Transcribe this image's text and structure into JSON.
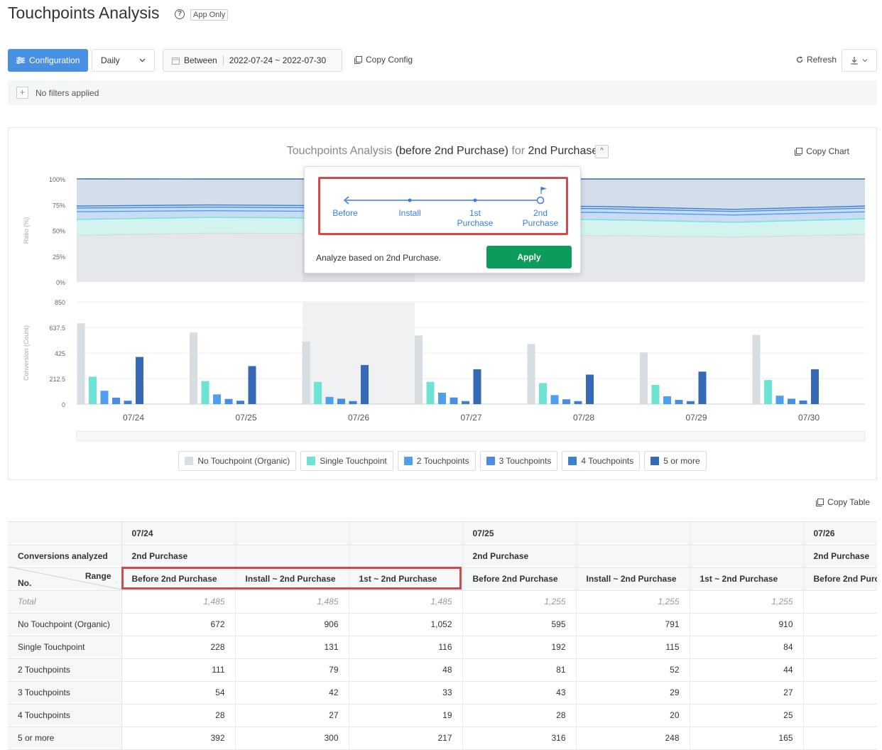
{
  "page": {
    "title": "Touchpoints Analysis",
    "help_icon": "?",
    "badge": "App Only"
  },
  "toolbar": {
    "configuration_label": "Configuration",
    "granularity": "Daily",
    "date_prefix": "Between",
    "date_range": "2022-07-24 ~ 2022-07-30",
    "copy_config_label": "Copy Config",
    "refresh_label": "Refresh",
    "icons": [
      "sliders-icon",
      "calendar-icon",
      "copy-icon",
      "refresh-icon",
      "download-icon",
      "chevron-down-icon"
    ]
  },
  "filters": {
    "add_icon": "+",
    "status_text": "No filters applied"
  },
  "chart": {
    "title_prefix": "Touchpoints Analysis",
    "title_scope": "(before 2nd Purchase)",
    "title_for": "for",
    "title_event": "2nd Purchase",
    "toggle_icon": "^",
    "copy_label": "Copy Chart",
    "ratio_axis_title": "Ratio (%)",
    "count_axis_title": "Conversion (Count)",
    "ratio_ticks": [
      "100%",
      "75%",
      "50%",
      "25%",
      "0%"
    ],
    "count_ticks": [
      "850",
      "637.5",
      "425",
      "212.5",
      "0"
    ],
    "highlighted_date": "07/26"
  },
  "chart_data": [
    {
      "type": "area",
      "ylabel": "Ratio (%)",
      "ylim": [
        0,
        100
      ],
      "x": [
        "07/24",
        "07/25",
        "07/26",
        "07/27",
        "07/28",
        "07/29",
        "07/30"
      ],
      "series": [
        {
          "name": "No Touchpoint (Organic)",
          "color": "#d6dde3",
          "values": [
            45.3,
            47.4,
            47.0,
            46.5,
            45.0,
            43.5,
            46.2
          ]
        },
        {
          "name": "Single Touchpoint",
          "color": "#6de3d4",
          "values": [
            15.4,
            15.3,
            15.0,
            15.0,
            15.5,
            14.5,
            15.1
          ]
        },
        {
          "name": "2 Touchpoints",
          "color": "#4e9fef",
          "values": [
            7.5,
            6.5,
            6.5,
            6.9,
            7.0,
            7.0,
            6.8
          ]
        },
        {
          "name": "3 Touchpoints",
          "color": "#4a8de0",
          "values": [
            3.6,
            3.4,
            3.5,
            3.6,
            3.7,
            3.5,
            3.6
          ]
        },
        {
          "name": "4 Touchpoints",
          "color": "#3f7fd2",
          "values": [
            1.9,
            2.2,
            2.0,
            2.0,
            2.1,
            2.0,
            2.0
          ]
        },
        {
          "name": "5 or more",
          "color": "#3568b5",
          "values": [
            26.4,
            25.2,
            26.0,
            26.0,
            26.7,
            29.5,
            26.3
          ]
        }
      ]
    },
    {
      "type": "bar",
      "ylabel": "Conversion (Count)",
      "ylim": [
        0,
        850
      ],
      "categories": [
        "07/24",
        "07/25",
        "07/26",
        "07/27",
        "07/28",
        "07/29",
        "07/30"
      ],
      "series": [
        {
          "name": "No Touchpoint (Organic)",
          "color": "#d6dde3",
          "values": [
            672,
            595,
            520,
            570,
            500,
            430,
            575
          ]
        },
        {
          "name": "Single Touchpoint",
          "color": "#6de3d4",
          "values": [
            228,
            192,
            185,
            185,
            175,
            160,
            200
          ]
        },
        {
          "name": "2 Touchpoints",
          "color": "#4e9fef",
          "values": [
            111,
            81,
            60,
            95,
            75,
            65,
            70
          ]
        },
        {
          "name": "3 Touchpoints",
          "color": "#4a8de0",
          "values": [
            54,
            43,
            45,
            55,
            40,
            35,
            45
          ]
        },
        {
          "name": "4 Touchpoints",
          "color": "#3f7fd2",
          "values": [
            28,
            28,
            25,
            25,
            25,
            25,
            30
          ]
        },
        {
          "name": "5 or more",
          "color": "#3568b5",
          "values": [
            392,
            316,
            325,
            290,
            245,
            270,
            290
          ]
        }
      ]
    }
  ],
  "legend": [
    {
      "label": "No Touchpoint (Organic)",
      "color": "#d6dde3"
    },
    {
      "label": "Single Touchpoint",
      "color": "#6de3d4"
    },
    {
      "label": "2 Touchpoints",
      "color": "#4e9fef"
    },
    {
      "label": "3 Touchpoints",
      "color": "#4a8de0"
    },
    {
      "label": "4 Touchpoints",
      "color": "#3f7fd2"
    },
    {
      "label": "5 or more",
      "color": "#3568b5"
    }
  ],
  "popover": {
    "steps": [
      {
        "label": "Before",
        "label2": ""
      },
      {
        "label": "Install",
        "label2": ""
      },
      {
        "label": "1st",
        "label2": "Purchase"
      },
      {
        "label": "2nd",
        "label2": "Purchase"
      }
    ],
    "description": "Analyze based on 2nd Purchase.",
    "apply_label": "Apply",
    "highlight_color": "#d34a4a"
  },
  "table": {
    "copy_label": "Copy Table",
    "corner_conversions": "Conversions analyzed",
    "corner_range": "Range",
    "corner_no": "No.",
    "dates": [
      "07/24",
      "",
      "",
      "07/25",
      "",
      "",
      "07/26"
    ],
    "conversions": [
      "2nd Purchase",
      "",
      "",
      "2nd Purchase",
      "",
      "",
      "2nd Purchase"
    ],
    "ranges": [
      "Before 2nd Purchase",
      "Install ~ 2nd Purchase",
      "1st ~ 2nd Purchase",
      "Before 2nd Purchase",
      "Install ~ 2nd Purchase",
      "1st ~ 2nd Purchase",
      "Before 2nd Purc"
    ],
    "rows": [
      {
        "label": "Total",
        "values": [
          "1,485",
          "1,485",
          "1,485",
          "1,255",
          "1,255",
          "1,255",
          ""
        ]
      },
      {
        "label": "No Touchpoint (Organic)",
        "values": [
          "672",
          "906",
          "1,052",
          "595",
          "791",
          "910",
          ""
        ]
      },
      {
        "label": "Single Touchpoint",
        "values": [
          "228",
          "131",
          "116",
          "192",
          "115",
          "84",
          ""
        ]
      },
      {
        "label": "2 Touchpoints",
        "values": [
          "111",
          "79",
          "48",
          "81",
          "52",
          "44",
          ""
        ]
      },
      {
        "label": "3 Touchpoints",
        "values": [
          "54",
          "42",
          "33",
          "43",
          "29",
          "27",
          ""
        ]
      },
      {
        "label": "4 Touchpoints",
        "values": [
          "28",
          "27",
          "19",
          "28",
          "20",
          "25",
          ""
        ]
      },
      {
        "label": "5 or more",
        "values": [
          "392",
          "300",
          "217",
          "316",
          "248",
          "165",
          ""
        ]
      }
    ]
  }
}
